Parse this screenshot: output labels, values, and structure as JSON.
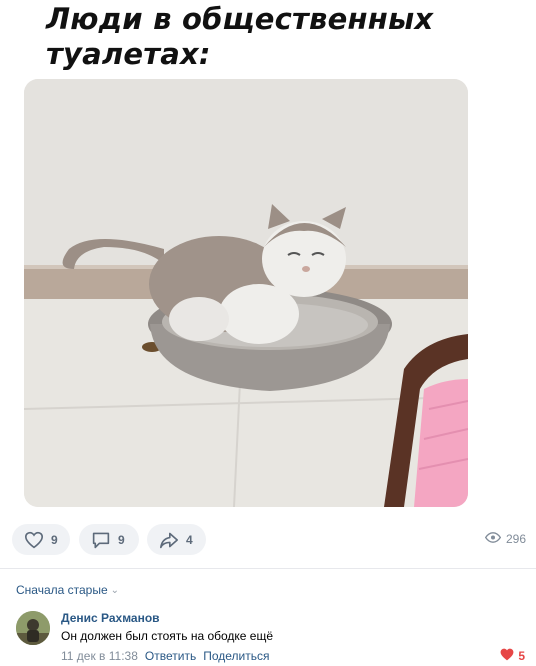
{
  "post": {
    "caption_lines": [
      "Люди в общественных",
      "туалетах:"
    ]
  },
  "actions": {
    "likes": "9",
    "comments": "9",
    "shares": "4",
    "views": "296"
  },
  "comments_section": {
    "sort_label": "Сначала старые",
    "items": [
      {
        "author": "Денис Рахманов",
        "text": "Он должен был стоять на ободке ещё",
        "time": "11 дек в 11:38",
        "reply_label": "Ответить",
        "share_label": "Поделиться",
        "likes": "5"
      }
    ]
  },
  "icons": {
    "like": "heart-outline-icon",
    "comment": "comment-bubble-icon",
    "share": "share-arrow-icon",
    "views": "eye-icon",
    "sort": "chevron-down-icon",
    "comment_like": "heart-filled-icon"
  },
  "colors": {
    "link": "#2a5885",
    "muted": "#818c99",
    "pill_bg": "#f0f2f5",
    "like_red": "#e64646"
  }
}
